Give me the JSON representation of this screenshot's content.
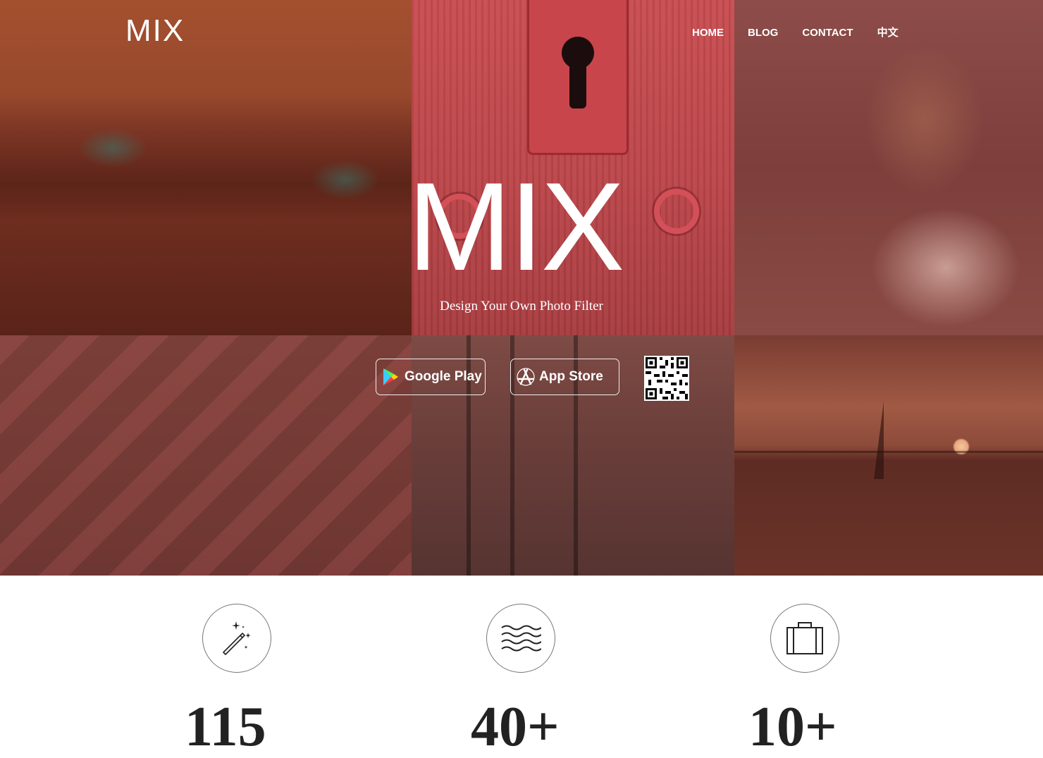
{
  "header": {
    "logo": "MIX",
    "nav": [
      "HOME",
      "BLOG",
      "CONTACT",
      "中文"
    ]
  },
  "hero": {
    "title": "MIX",
    "subtitle": "Design Your Own Photo Filter"
  },
  "downloads": {
    "google_play": "Google Play",
    "app_store": "App Store"
  },
  "features": [
    {
      "icon": "magic-wand-icon",
      "stat": "115"
    },
    {
      "icon": "waves-icon",
      "stat": "40+"
    },
    {
      "icon": "briefcase-icon",
      "stat": "10+"
    }
  ],
  "colors": {
    "overlay": "#8a3d36",
    "accent": "#c8454c",
    "text": "#ffffff"
  }
}
